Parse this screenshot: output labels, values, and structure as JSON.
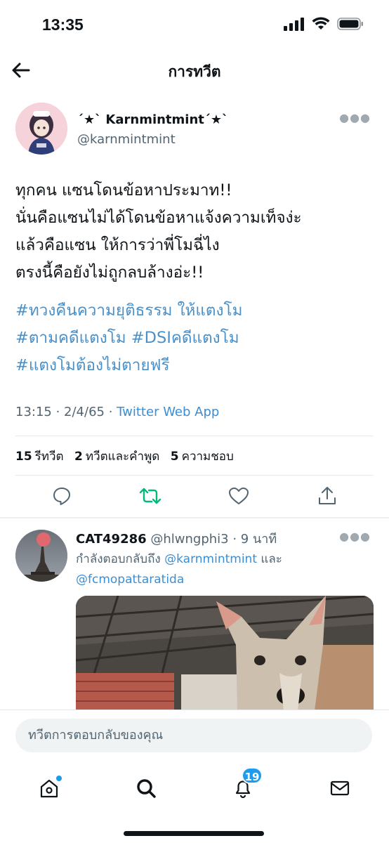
{
  "status_bar": {
    "time": "13:35"
  },
  "header": {
    "title": "การทวีต"
  },
  "tweet": {
    "author_name": "´★` Karnmintmint´★`",
    "author_handle": "@karnmintmint",
    "text_lines": [
      "ทุกคน แซนโดนข้อหาประมาท!!",
      "นั่นคือแซนไม่ได้โดนข้อหาแจ้งความเท็จง่ะ",
      "แล้วคือแซน ให้การว่าพี่โมฉี่ไง",
      "ตรงนี้คือยังไม่ถูกลบล้างอ่ะ!!"
    ],
    "hashtag_lines": [
      "#ทวงคืนความยุติธรรม ให้แตงโม",
      "#ตามคดีแตงโม #DSIคดีแตงโม",
      "#แตงโมต้องไม่ตายฟรี"
    ],
    "time": "13:15 · 2/4/65 · ",
    "source": "Twitter Web App",
    "stats": {
      "retweets_count": "15",
      "retweets_label": "รีทวีต",
      "quotes_count": "2",
      "quotes_label": "ทวีตและคำพูด",
      "likes_count": "5",
      "likes_label": "ความชอบ"
    },
    "retweet_color": "#00ba7c"
  },
  "reply": {
    "name": "CAT49286",
    "handle": " @hlwngphi3 · 9 นาที",
    "replying_prefix": "กำลังตอบกลับถึง ",
    "mention_1": "@karnmintmint",
    "replying_joiner": " และ",
    "mention_2": "@fcmopattaratida"
  },
  "composer": {
    "placeholder": "ทวีตการตอบกลับของคุณ"
  },
  "bottom_nav": {
    "notifications_badge": "19"
  },
  "colors": {
    "accent": "#1d9bf0",
    "link": "#3b8ed4",
    "muted": "#536471"
  }
}
